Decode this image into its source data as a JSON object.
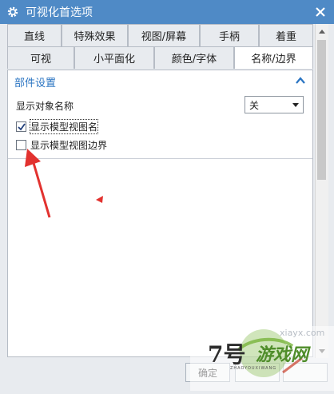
{
  "window": {
    "title": "可视化首选项"
  },
  "tabs": {
    "row1": [
      {
        "label": "直线"
      },
      {
        "label": "特殊效果"
      },
      {
        "label": "视图/屏幕"
      },
      {
        "label": "手柄"
      },
      {
        "label": "着重"
      }
    ],
    "row2": [
      {
        "label": "可视"
      },
      {
        "label": "小平面化"
      },
      {
        "label": "颜色/字体"
      },
      {
        "label": "名称/边界",
        "active": true
      }
    ]
  },
  "section": {
    "title": "部件设置",
    "show_object_name_label": "显示对象名称",
    "show_object_name_value": "关",
    "show_model_view_name_label": "显示模型视图名",
    "show_model_view_name_checked": true,
    "show_model_view_border_label": "显示模型视图边界",
    "show_model_view_border_checked": false
  },
  "footer": {
    "ok_label": "确定"
  },
  "watermark": {
    "brand_number": "7号",
    "brand_text": "游戏网",
    "brand_pinyin": "ZHAOYOUXIWANG",
    "site": "xiayx.com"
  },
  "colors": {
    "titlebar": "#4f8ac6",
    "section_title": "#2a74c2",
    "annotation_arrow": "#e2322f"
  }
}
